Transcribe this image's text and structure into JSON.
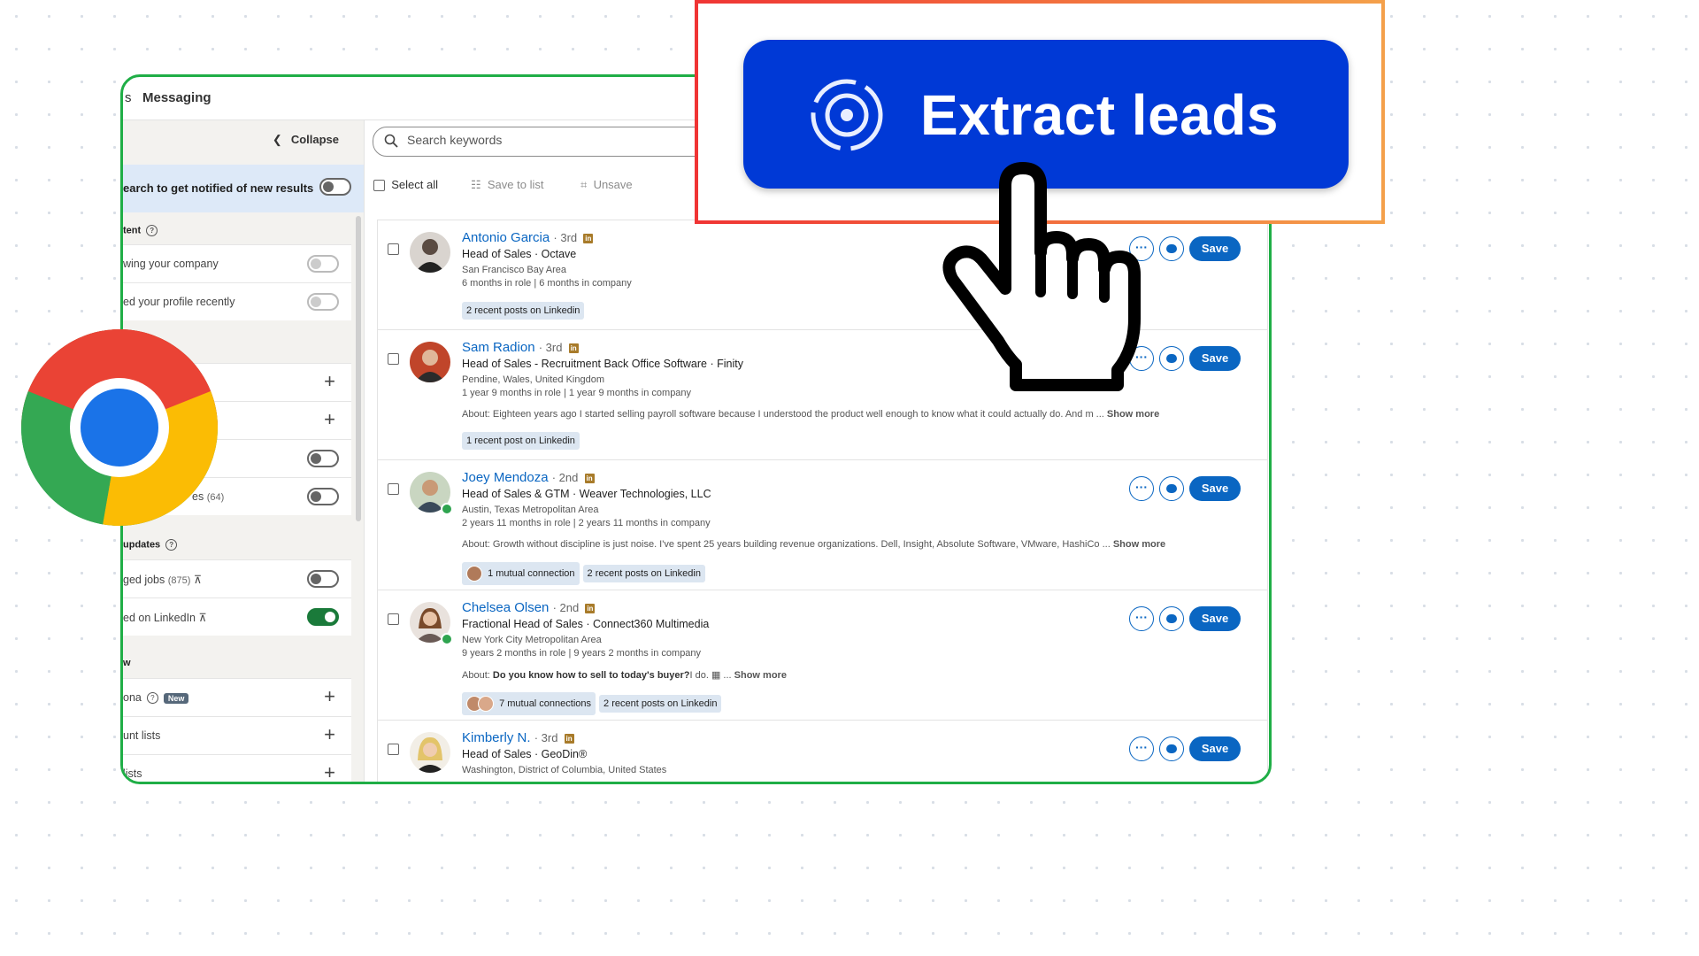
{
  "topbar": {
    "partial_tab": "s",
    "messaging": "Messaging"
  },
  "sidebar": {
    "collapse": "Collapse",
    "notify": "earch to get notified of new results",
    "sections": [
      {
        "label": "tent"
      },
      {
        "label": "updates"
      },
      {
        "label": "w"
      }
    ],
    "rows": [
      {
        "label": "wing your company"
      },
      {
        "label": "ed your profile recently"
      },
      {
        "label": "es",
        "count": "(64)"
      },
      {
        "label": "ged jobs",
        "count": "(875)"
      },
      {
        "label": "ed on LinkedIn"
      },
      {
        "label": "ona",
        "badge": "New"
      },
      {
        "label": "unt lists"
      },
      {
        "label": "lists"
      }
    ]
  },
  "search": {
    "placeholder": "Search keywords"
  },
  "toolbar": {
    "select_all": "Select all",
    "save_to_list": "Save to list",
    "unsave": "Unsave"
  },
  "actions": {
    "more": "···",
    "save": "Save"
  },
  "leads": [
    {
      "name": "Antonio Garcia",
      "degree": "· 3rd",
      "li": "in",
      "title": "Head of Sales · Octave",
      "location": "San Francisco Bay Area",
      "tenure": "6 months in role | 6 months in company",
      "chips": [
        "2 recent posts on Linkedin"
      ]
    },
    {
      "name": "Sam Radion",
      "degree": "· 3rd",
      "li": "in",
      "title": "Head of Sales - Recruitment Back Office Software · Finity",
      "location": "Pendine, Wales, United Kingdom",
      "tenure": "1 year 9 months in role | 1 year 9 months in company",
      "about_label": "About:",
      "about": "Eighteen years ago I started selling payroll software because I understood the product well enough to know what it could actually do. And m ...",
      "show_more": "Show more",
      "chips": [
        "1 recent post on Linkedin"
      ]
    },
    {
      "name": "Joey Mendoza",
      "degree": "· 2nd",
      "li": "in",
      "title": "Head of Sales & GTM · Weaver Technologies, LLC",
      "location": "Austin, Texas Metropolitan Area",
      "tenure": "2 years 11 months in role | 2 years 11 months in company",
      "about_label": "About:",
      "about": "Growth without discipline is just noise. I've spent 25 years building revenue organizations. Dell, Insight, Absolute Software, VMware, HashiCo ...",
      "show_more": "Show more",
      "chips": [
        "1 mutual connection",
        "2 recent posts on Linkedin"
      ]
    },
    {
      "name": "Chelsea Olsen",
      "degree": "· 2nd",
      "li": "in",
      "title": "Fractional Head of Sales · Connect360 Multimedia",
      "location": "New York City Metropolitan Area",
      "tenure": "9 years 2 months in role | 9 years 2 months in company",
      "about_label": "About:",
      "about_bold": "Do you know how to sell to today's buyer?",
      "about": "I do. ▦ ...",
      "show_more": "Show more",
      "chips": [
        "7 mutual connections",
        "2 recent posts on Linkedin"
      ]
    },
    {
      "name": "Kimberly N.",
      "degree": "· 3rd",
      "li": "in",
      "title": "Head of Sales · GeoDin®",
      "location": "Washington, District of Columbia, United States"
    }
  ],
  "overlay": {
    "button_label": "Extract leads"
  },
  "icons": [
    "search-icon",
    "target-icon",
    "pointer-hand-icon",
    "chrome-logo",
    "linkedin-icon",
    "more-icon",
    "message-icon",
    "bookmark-icon",
    "list-icon"
  ],
  "colors": {
    "frame": "#1fae46",
    "primary": "#0a66c2",
    "extract_button": "#0039d6",
    "callout_border_start": "#f03434",
    "callout_border_end": "#f4a04a"
  }
}
